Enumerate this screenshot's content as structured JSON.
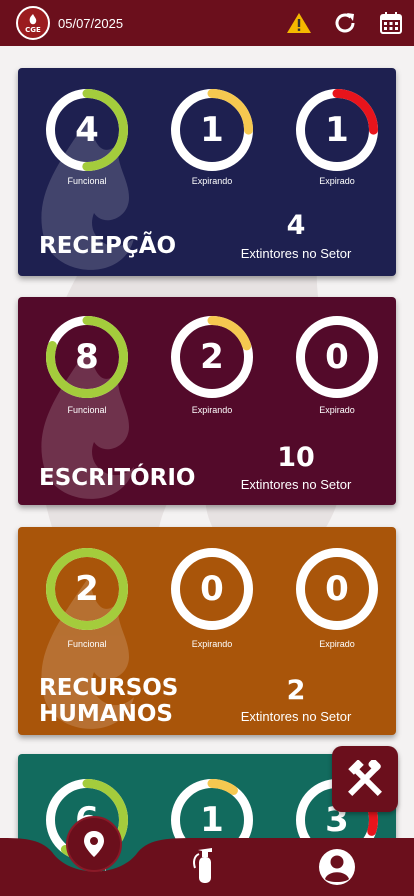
{
  "header": {
    "logo_text": "CGE",
    "date": "05/07/2025",
    "icons": [
      "warning-icon",
      "refresh-icon",
      "calendar-icon"
    ]
  },
  "colors": {
    "header": "#6b0f1c",
    "functional": "#a4cc3c",
    "expiring": "#f5c850",
    "expired": "#e8141c",
    "ring_base": "#ffffff"
  },
  "labels": {
    "functional": "Funcional",
    "expiring": "Expirando",
    "expired": "Expirado",
    "total": "Extintores no Setor"
  },
  "sectors": [
    {
      "name": "RECEPÇÃO",
      "name_line2": "",
      "color": "#1e2050",
      "functional": "4",
      "expiring": "1",
      "expired": "1",
      "total": "4",
      "fill": {
        "functional": 0.5,
        "expiring": 0.25,
        "expired": 0.25
      }
    },
    {
      "name": "ESCRITÓRIO",
      "name_line2": "",
      "color": "#530a2a",
      "functional": "8",
      "expiring": "2",
      "expired": "0",
      "total": "10",
      "fill": {
        "functional": 0.8,
        "expiring": 0.2,
        "expired": 0
      }
    },
    {
      "name": "RECURSOS",
      "name_line2": "HUMANOS",
      "color": "#a9550a",
      "functional": "2",
      "expiring": "0",
      "expired": "0",
      "total": "2",
      "fill": {
        "functional": 1,
        "expiring": 0,
        "expired": 0
      }
    },
    {
      "name": "",
      "name_line2": "",
      "color": "#126b5e",
      "functional": "6",
      "expiring": "1",
      "expired": "3",
      "total": "",
      "fill": {
        "functional": 0.6,
        "expiring": 0.1,
        "expired": 0.3
      }
    }
  ],
  "nav": {
    "items": [
      "location-icon",
      "fire-extinguisher-icon",
      "user-icon"
    ]
  },
  "fab_icon": "tools-icon"
}
